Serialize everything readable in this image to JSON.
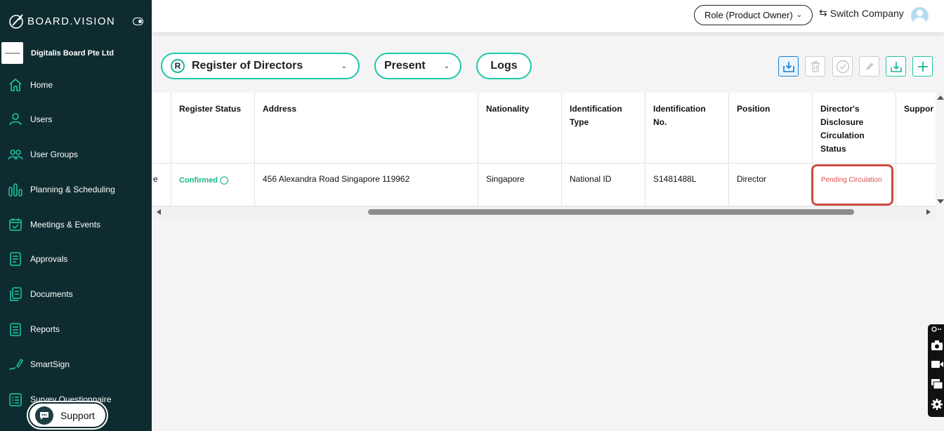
{
  "app": {
    "brand": "BOARD.VISION"
  },
  "sidebar": {
    "company_name": "Digitalis Board Pte Ltd",
    "items": [
      {
        "label": "Home",
        "icon": "home-icon"
      },
      {
        "label": "Users",
        "icon": "user-icon"
      },
      {
        "label": "User Groups",
        "icon": "user-group-icon"
      },
      {
        "label": "Planning & Scheduling",
        "icon": "chart-bars-icon"
      },
      {
        "label": "Meetings & Events",
        "icon": "calendar-icon"
      },
      {
        "label": "Approvals",
        "icon": "approval-document-icon"
      },
      {
        "label": "Documents",
        "icon": "documents-icon"
      },
      {
        "label": "Reports",
        "icon": "report-icon"
      },
      {
        "label": "SmartSign",
        "icon": "signature-pen-icon"
      },
      {
        "label": "Survey Questionnaire",
        "icon": "survey-icon"
      }
    ],
    "support_label": "Support"
  },
  "header": {
    "role_label": "Role (Product Owner)",
    "switch_company_label": "Switch Company"
  },
  "toolbar": {
    "register_label": "Register of Directors",
    "register_badge": "R",
    "present_label": "Present",
    "logs_label": "Logs",
    "tools": [
      "import-icon",
      "delete-icon",
      "check-circle-icon",
      "edit-icon",
      "download-icon",
      "add-icon"
    ]
  },
  "table": {
    "columns": [
      "Register Status",
      "Address",
      "Nationality",
      "Identification Type",
      "Identification No.",
      "Position",
      "Director's Disclosure Circulation Status",
      "Suppor"
    ],
    "rows": [
      {
        "first_cell_fragment": "e",
        "register_status": "Confirmed",
        "address": "456 Alexandra Road Singapore 119962",
        "nationality": "Singapore",
        "identification_type": "National ID",
        "identification_no": "S1481488L",
        "position": "Director",
        "disclosure_status": "Pending Circulation",
        "supporting": ""
      }
    ]
  },
  "colors": {
    "sidebar_bg": "#0e2c30",
    "accent": "#1ec7a8",
    "confirmed": "#14b88a",
    "pending": "#e0534a",
    "highlight_border": "#cc4b3e"
  }
}
